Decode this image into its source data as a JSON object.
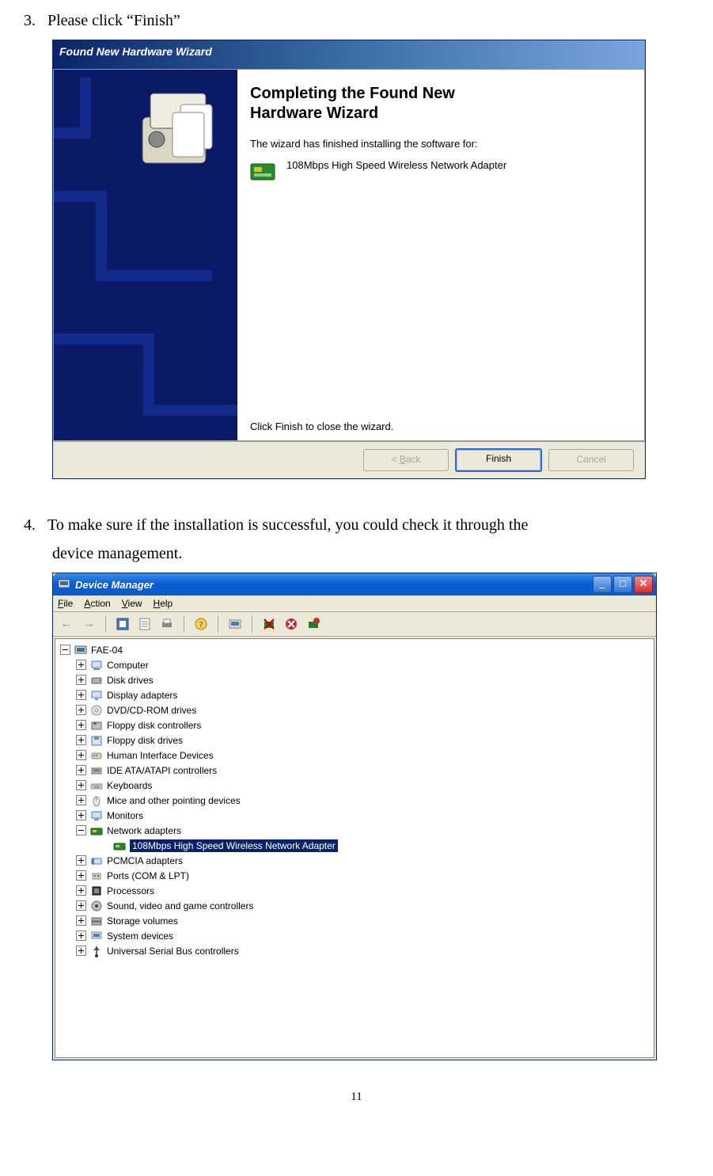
{
  "step3": {
    "num": "3.",
    "text": "Please click “Finish”"
  },
  "step4": {
    "num": "4.",
    "text": "To make sure if the installation is successful, you could check it through the device management."
  },
  "wizard": {
    "title": "Found New Hardware Wizard",
    "heading_l1": "Completing the Found New",
    "heading_l2": "Hardware Wizard",
    "line1": "The wizard has finished installing the software for:",
    "device_name": "108Mbps High Speed Wireless Network Adapter",
    "close_hint": "Click Finish to close the wizard.",
    "buttons": {
      "back_pre": "< ",
      "back_u": "B",
      "back_post": "ack",
      "finish": "Finish",
      "cancel": "Cancel"
    }
  },
  "devmgr": {
    "title": "Device Manager",
    "menu": {
      "file_u": "F",
      "file_post": "ile",
      "action_u": "A",
      "action_post": "ction",
      "view_u": "V",
      "view_post": "iew",
      "help_u": "H",
      "help_post": "elp"
    },
    "root": "FAE-04",
    "nodes": [
      {
        "label": "Computer",
        "icon": "computer-icon"
      },
      {
        "label": "Disk drives",
        "icon": "disk-icon"
      },
      {
        "label": "Display adapters",
        "icon": "display-icon"
      },
      {
        "label": "DVD/CD-ROM drives",
        "icon": "cd-icon"
      },
      {
        "label": "Floppy disk controllers",
        "icon": "floppy-ctrl-icon"
      },
      {
        "label": "Floppy disk drives",
        "icon": "floppy-icon"
      },
      {
        "label": "Human Interface Devices",
        "icon": "hid-icon"
      },
      {
        "label": "IDE ATA/ATAPI controllers",
        "icon": "ide-icon"
      },
      {
        "label": "Keyboards",
        "icon": "keyboard-icon"
      },
      {
        "label": "Mice and other pointing devices",
        "icon": "mouse-icon"
      },
      {
        "label": "Monitors",
        "icon": "monitor-icon"
      },
      {
        "label": "Network adapters",
        "icon": "network-icon",
        "expanded": true,
        "children": [
          {
            "label": "108Mbps High Speed Wireless Network Adapter",
            "icon": "network-card-icon",
            "selected": true
          }
        ]
      },
      {
        "label": "PCMCIA adapters",
        "icon": "pcmcia-icon"
      },
      {
        "label": "Ports (COM & LPT)",
        "icon": "port-icon"
      },
      {
        "label": "Processors",
        "icon": "cpu-icon"
      },
      {
        "label": "Sound, video and game controllers",
        "icon": "sound-icon"
      },
      {
        "label": "Storage volumes",
        "icon": "storage-icon"
      },
      {
        "label": "System devices",
        "icon": "system-icon"
      },
      {
        "label": "Universal Serial Bus controllers",
        "icon": "usb-icon"
      }
    ]
  },
  "page_number": "11"
}
